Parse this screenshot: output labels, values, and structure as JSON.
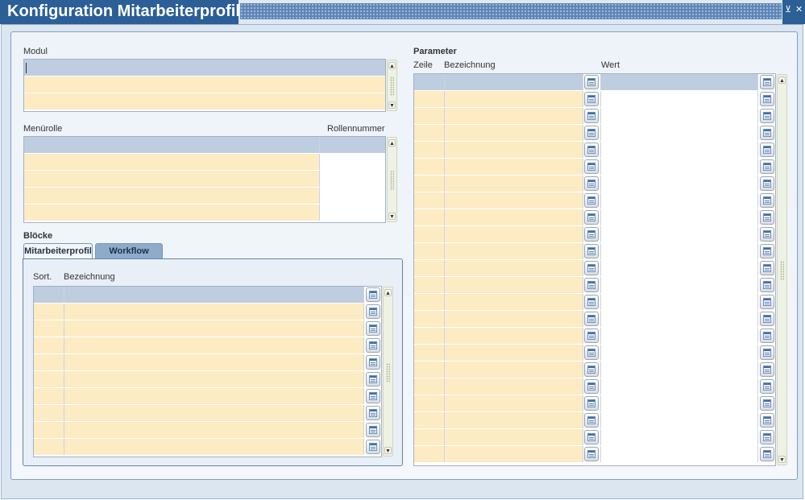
{
  "window": {
    "title": "Konfiguration Mitarbeiterprofil",
    "minimize_glyph": "⊻",
    "close_glyph": "✕"
  },
  "modul": {
    "label": "Modul",
    "rows": 3
  },
  "menurolle": {
    "label": "Menürolle",
    "col_rollennummer": "Rollennummer",
    "rows": 5
  },
  "bloecke": {
    "label": "Blöcke",
    "tabs": [
      {
        "label": "Mitarbeiterprofil",
        "active": true
      },
      {
        "label": "Workflow",
        "active": false
      }
    ],
    "col_sort": "Sort.",
    "col_bezeichnung": "Bezeichnung",
    "rows": 10
  },
  "parameter": {
    "label": "Parameter",
    "col_zeile": "Zeile",
    "col_bezeichnung": "Bezeichnung",
    "col_wert": "Wert",
    "rows": 23
  },
  "scroll": {
    "up": "▲",
    "down": "▼"
  },
  "colors": {
    "title_blue": "#2b5f96",
    "row_peach": "#fdebc3",
    "row_header_blue": "#bfcde0",
    "window_bg": "#dbe6f1"
  },
  "icons": {
    "lov": "list-of-values-icon",
    "close": "close-icon",
    "minimize": "minimize-icon"
  }
}
